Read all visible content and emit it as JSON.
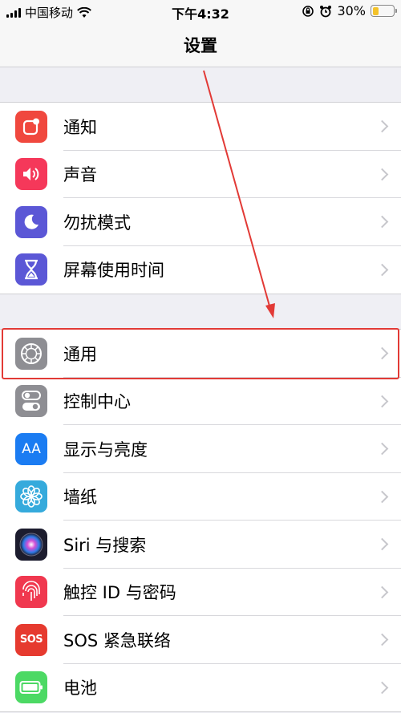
{
  "status": {
    "carrier": "中国移动",
    "time": "下午4:32",
    "battery": "30%",
    "battery_level": 0.3
  },
  "nav": {
    "title": "设置"
  },
  "group1": [
    {
      "label": "通知",
      "icon": "notifications-icon",
      "color": "#f0483e"
    },
    {
      "label": "声音",
      "icon": "sounds-icon",
      "color": "#f5385a"
    },
    {
      "label": "勿扰模式",
      "icon": "moon-icon",
      "color": "#5b57d6"
    },
    {
      "label": "屏幕使用时间",
      "icon": "hourglass-icon",
      "color": "#5b57d6"
    }
  ],
  "group2": [
    {
      "label": "通用",
      "icon": "gear-icon",
      "color": "#8e8e93"
    },
    {
      "label": "控制中心",
      "icon": "toggles-icon",
      "color": "#8e8e93"
    },
    {
      "label": "显示与亮度",
      "icon": "text-size-icon",
      "color": "#1b7cf2",
      "glyph": "AA"
    },
    {
      "label": "墙纸",
      "icon": "flower-icon",
      "color": "#35aadc"
    },
    {
      "label": "Siri 与搜索",
      "icon": "siri-icon",
      "color": "#1c1c2e"
    },
    {
      "label": "触控 ID 与密码",
      "icon": "fingerprint-icon",
      "color": "#f0384f"
    },
    {
      "label": "SOS 紧急联络",
      "icon": "sos-icon",
      "color": "#e63a2f",
      "glyph": "SOS"
    },
    {
      "label": "电池",
      "icon": "battery-icon",
      "color": "#4cd964"
    }
  ]
}
